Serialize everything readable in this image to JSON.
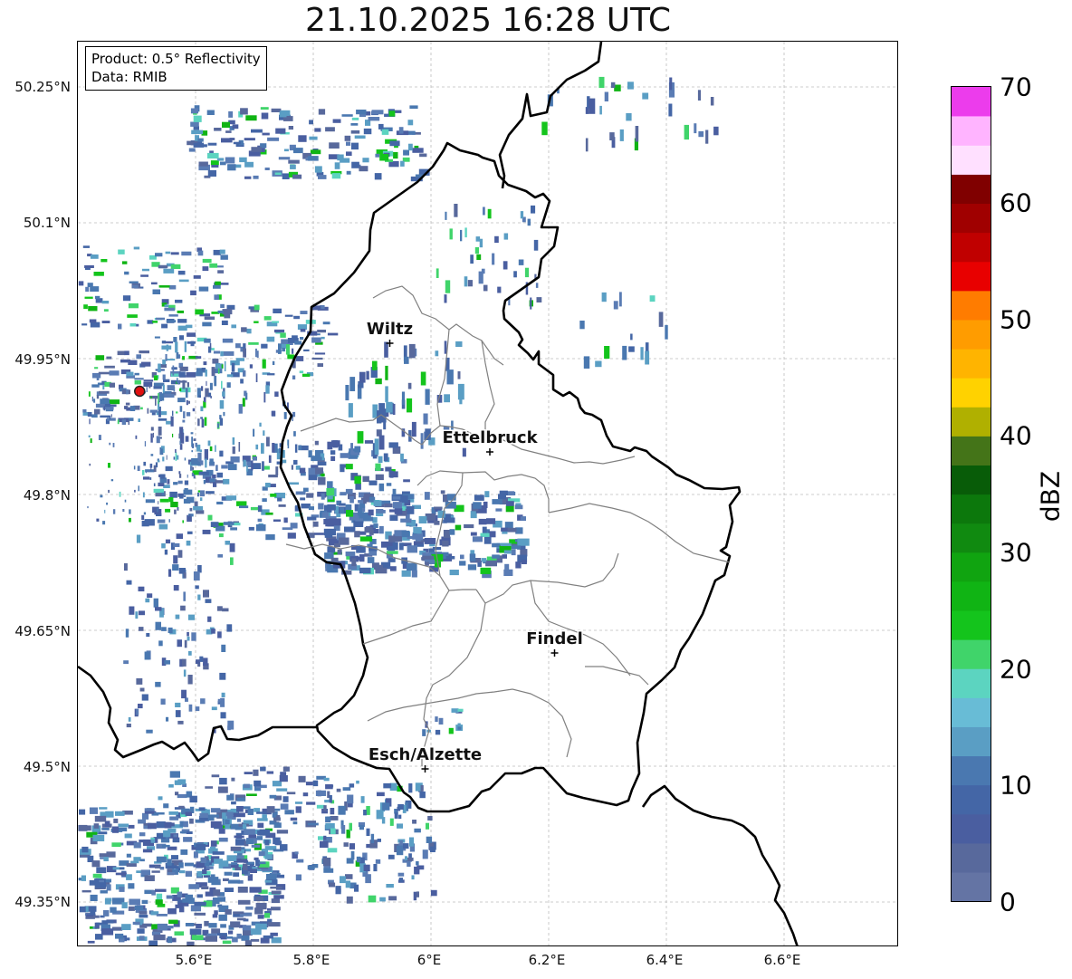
{
  "title": "21.10.2025 16:28 UTC",
  "info": {
    "product": "Product: 0.5° Reflectivity",
    "data": "Data: RMIB"
  },
  "lat_ticks": [
    "50.25°N",
    "50.1°N",
    "49.95°N",
    "49.8°N",
    "49.65°N",
    "49.5°N",
    "49.35°N"
  ],
  "lon_ticks": [
    "5.6°E",
    "5.8°E",
    "6°E",
    "6.2°E",
    "6.4°E",
    "6.6°E"
  ],
  "colorbar": {
    "label": "dBZ",
    "ticks": [
      "0",
      "10",
      "20",
      "30",
      "40",
      "50",
      "60",
      "70"
    ],
    "colors": [
      "#6474a4",
      "#58699c",
      "#4a5ea0",
      "#4466a6",
      "#4a78b0",
      "#5a9ec4",
      "#68bcd6",
      "#5cd4c0",
      "#40d46a",
      "#14c41c",
      "#10b414",
      "#10a410",
      "#108a10",
      "#0c780c",
      "#085c08",
      "#447418",
      "#b0b000",
      "#ffd200",
      "#ffb400",
      "#ff9c00",
      "#ff7c00",
      "#e80000",
      "#c00000",
      "#a00000",
      "#800000",
      "#ffe0ff",
      "#ffb4ff",
      "#ff6cff",
      "#ec3cec"
    ]
  },
  "cities": [
    {
      "name": "Wiltz",
      "lon": 5.93,
      "lat": 49.967
    },
    {
      "name": "Ettelbruck",
      "lon": 6.1,
      "lat": 49.847
    },
    {
      "name": "Findel",
      "lon": 6.21,
      "lat": 49.625
    },
    {
      "name": "Esch/Alzette",
      "lon": 5.99,
      "lat": 49.497
    }
  ],
  "radar_site": {
    "lon": 5.505,
    "lat": 49.914
  }
}
